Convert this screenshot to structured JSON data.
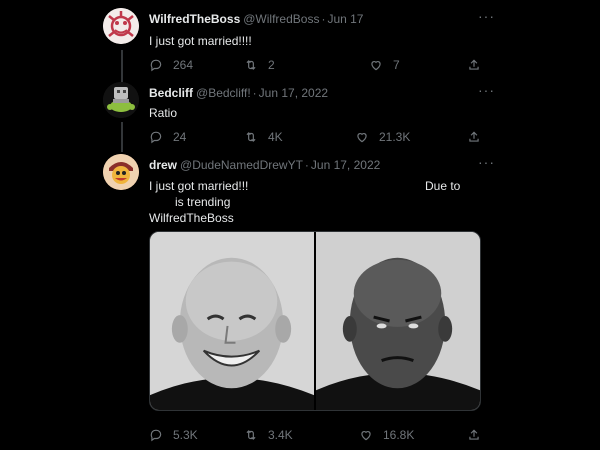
{
  "tweets": [
    {
      "name": "WilfredTheBoss",
      "handle": "@WilfredBoss",
      "time": "Jun 17",
      "text": "I just got married!!!!",
      "replies": "264",
      "retweets": "2",
      "likes": "7"
    },
    {
      "name": "Bedcliff",
      "handle": "@Bedcliff!",
      "time": "Jun 17, 2022",
      "text": "Ratio",
      "replies": "24",
      "retweets": "4K",
      "likes": "21.3K"
    },
    {
      "name": "drew",
      "handle": "@DudeNamedDrewYT",
      "time": "Jun 17, 2022",
      "text_line1": "I just got married!!!",
      "text_right": "Due to",
      "text_line2": "is trending",
      "text_line3": "WilfredTheBoss",
      "replies": "5.3K",
      "retweets": "3.4K",
      "likes": "16.8K"
    }
  ],
  "ui": {
    "separator": "·",
    "more": "···"
  },
  "colors": {
    "background": "#000000",
    "primary_text": "#e7e9ea",
    "secondary_text": "#71767b",
    "border": "#2f3336"
  },
  "icons": [
    "reply-icon",
    "retweet-icon",
    "like-icon",
    "share-icon",
    "more-icon"
  ]
}
